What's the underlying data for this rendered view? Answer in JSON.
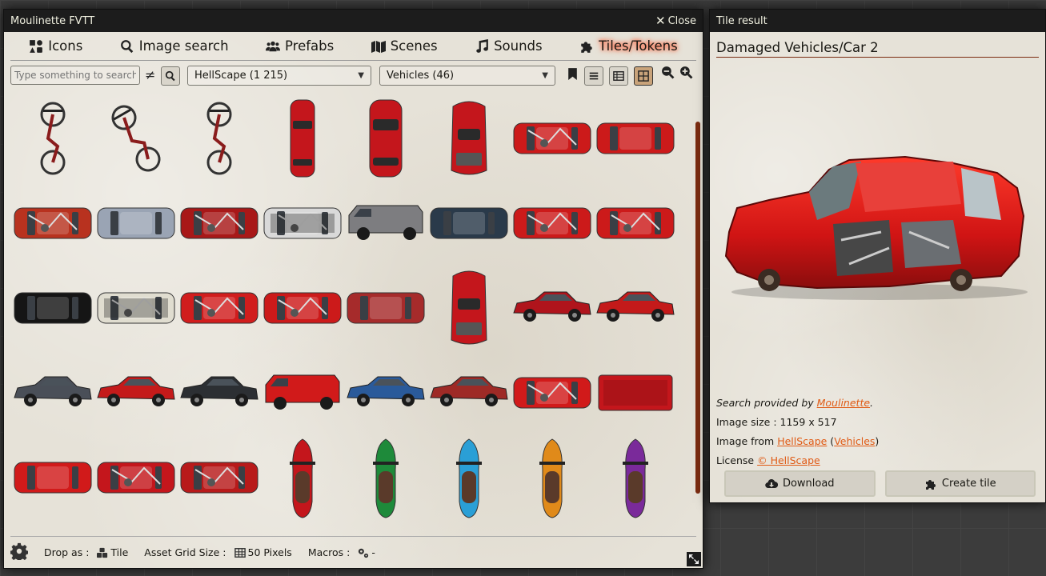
{
  "main_window": {
    "title": "Moulinette FVTT",
    "close_label": "Close",
    "tabs": [
      {
        "label": "Icons",
        "icon": "shapes-icon"
      },
      {
        "label": "Image search",
        "icon": "search-icon"
      },
      {
        "label": "Prefabs",
        "icon": "users-icon"
      },
      {
        "label": "Scenes",
        "icon": "map-icon"
      },
      {
        "label": "Sounds",
        "icon": "music-icon"
      },
      {
        "label": "Tiles/Tokens",
        "icon": "puzzle-icon",
        "active": true
      }
    ],
    "search": {
      "placeholder": "Type something to search.",
      "value": ""
    },
    "not_equal_symbol": "≠",
    "pack_select": {
      "value": "HellScape (1 215)"
    },
    "category_select": {
      "value": "Vehicles (46)"
    },
    "view_icons": [
      "bookmark-icon",
      "list-icon",
      "table-icon",
      "grid-icon"
    ],
    "zoom_icons": [
      "zoom-out-icon",
      "zoom-in-icon"
    ],
    "assets": [
      {
        "kind": "bike-vertical",
        "color": "#8a1c1c"
      },
      {
        "kind": "bike-angled",
        "color": "#8a1c1c"
      },
      {
        "kind": "bike-top",
        "color": "#8a1c1c"
      },
      {
        "kind": "car-vertical",
        "color": "#c4161c"
      },
      {
        "kind": "car-vertical-wide",
        "color": "#c4161c"
      },
      {
        "kind": "car-vertical-sport",
        "color": "#c4161c"
      },
      {
        "kind": "car-wreck-h",
        "color": "#cc1a1a"
      },
      {
        "kind": "car-h",
        "color": "#cc1a1a"
      },
      {
        "kind": "car-wreck-h",
        "color": "#b8321f"
      },
      {
        "kind": "car-h",
        "color": "#9aa4b4"
      },
      {
        "kind": "car-wreck-h",
        "color": "#a81818"
      },
      {
        "kind": "car-burnt-h",
        "color": "#d9d9d9"
      },
      {
        "kind": "van-side",
        "color": "#7d7d80"
      },
      {
        "kind": "car-h",
        "color": "#2a3a4a"
      },
      {
        "kind": "car-wreck-h",
        "color": "#cc1a1a"
      },
      {
        "kind": "car-wreck-h",
        "color": "#cc1a1a"
      },
      {
        "kind": "car-h",
        "color": "#151515"
      },
      {
        "kind": "car-burnt-h",
        "color": "#e0ddd0"
      },
      {
        "kind": "car-wreck-h",
        "color": "#d11d1d"
      },
      {
        "kind": "car-wreck-h",
        "color": "#cc1a1a"
      },
      {
        "kind": "car-h",
        "color": "#a62b2b"
      },
      {
        "kind": "car-vertical-sport",
        "color": "#c4161c"
      },
      {
        "kind": "car-side",
        "color": "#b0141c"
      },
      {
        "kind": "car-side",
        "color": "#c41a1a"
      },
      {
        "kind": "car-side",
        "color": "#4a4f58"
      },
      {
        "kind": "car-side",
        "color": "#c41a1a"
      },
      {
        "kind": "car-side",
        "color": "#2c2f33"
      },
      {
        "kind": "van-side",
        "color": "#d11a1a"
      },
      {
        "kind": "car-side",
        "color": "#2a5a9a"
      },
      {
        "kind": "car-side",
        "color": "#9e2a26"
      },
      {
        "kind": "car-wreck-h",
        "color": "#d11a1a"
      },
      {
        "kind": "van-top",
        "color": "#c4161c"
      },
      {
        "kind": "car-h",
        "color": "#d11a1a"
      },
      {
        "kind": "car-wreck-h",
        "color": "#c4161c"
      },
      {
        "kind": "car-wreck-h",
        "color": "#b81a1a"
      },
      {
        "kind": "moto",
        "color": "#c4161c"
      },
      {
        "kind": "moto",
        "color": "#1e8a3a"
      },
      {
        "kind": "moto",
        "color": "#2a9fd6"
      },
      {
        "kind": "moto",
        "color": "#e08a1a"
      },
      {
        "kind": "moto",
        "color": "#7a2a9a"
      },
      {
        "kind": "moto-tip",
        "color": "#c4161c"
      },
      {
        "kind": "moto-tip",
        "color": "#5a1a10"
      },
      {
        "kind": "moto-tip",
        "color": "#e8e8e8"
      },
      {
        "kind": "moto-tip",
        "color": "#e0d01a"
      }
    ],
    "footer": {
      "drop_as_label": "Drop as :",
      "drop_as_value": "Tile",
      "grid_size_label": "Asset Grid Size :",
      "grid_size_value": "50 Pixels",
      "macros_label": "Macros :",
      "macros_value": "-"
    }
  },
  "tile_window": {
    "title": "Tile result",
    "asset_title": "Damaged Vehicles/Car 2",
    "search_provided_prefix": "Search provided by ",
    "search_provider": "Moulinette",
    "search_provided_suffix": ".",
    "image_size_label": "Image size : ",
    "image_size_value": "1159 x 517",
    "image_from_label": "Image from ",
    "image_from_pack": "HellScape",
    "image_from_category": "Vehicles",
    "license_label": "License ",
    "license_value": "© HellScape",
    "download_label": "Download",
    "create_tile_label": "Create tile"
  },
  "colors": {
    "accent_glow": "#ff5a33",
    "link": "#e05a14",
    "header_bg": "#1c1c1c",
    "scroll_thumb": "#7a2b10"
  }
}
